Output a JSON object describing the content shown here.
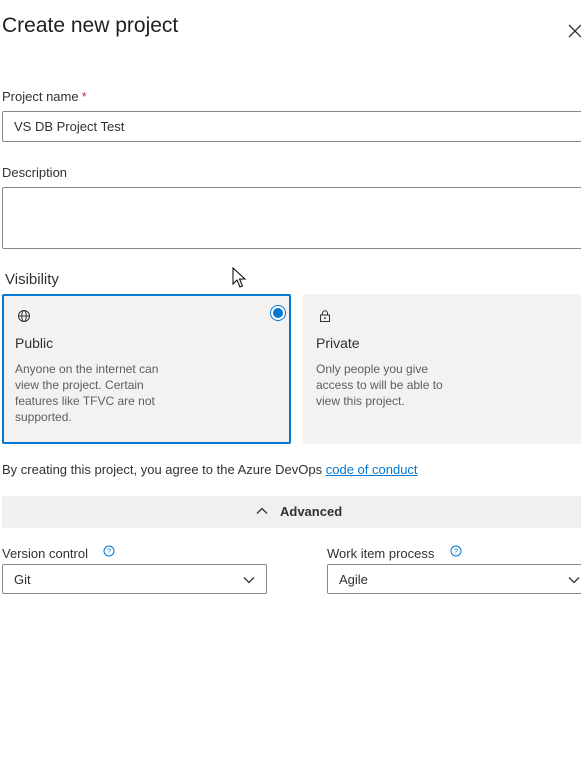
{
  "dialog": {
    "title": "Create new project"
  },
  "project_name": {
    "label": "Project name",
    "required_marker": "*",
    "value": "VS DB Project Test"
  },
  "description": {
    "label": "Description",
    "value": ""
  },
  "visibility": {
    "label": "Visibility",
    "selected": "Public",
    "options": [
      {
        "icon": "globe-icon",
        "title": "Public",
        "description": "Anyone on the internet can view the project. Certain features like TFVC are not supported."
      },
      {
        "icon": "lock-icon",
        "title": "Private",
        "description": "Only people you give access to will be able to view this project."
      }
    ]
  },
  "terms": {
    "text": "By creating this project, you agree to the Azure DevOps",
    "link_text": "code of conduct"
  },
  "advanced": {
    "label": "Advanced",
    "expanded": true
  },
  "version_control": {
    "label": "Version control",
    "value": "Git"
  },
  "work_item_process": {
    "label": "Work item process",
    "value": "Agile"
  },
  "colors": {
    "accent": "#0078d4",
    "required": "#c4314b",
    "card_background": "#f3f2f1"
  }
}
